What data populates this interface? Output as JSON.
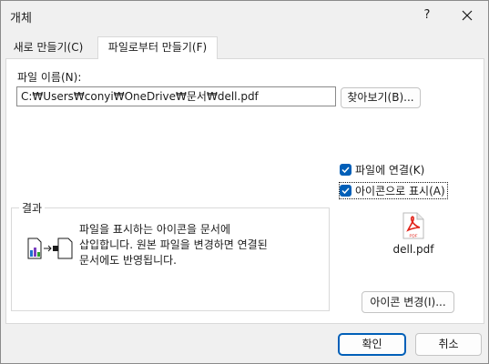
{
  "window": {
    "title": "개체",
    "help_label": "?"
  },
  "tabs": [
    {
      "label": "새로 만들기(C)",
      "active": false
    },
    {
      "label": "파일로부터 만들기(F)",
      "active": true
    }
  ],
  "file": {
    "label": "파일 이름(N):",
    "value": "C:₩Users₩conyi₩OneDrive₩문서₩dell.pdf",
    "browse_label": "찾아보기(B)..."
  },
  "options": {
    "link_label": "파일에 연결(K)",
    "link_checked": true,
    "icon_label": "아이콘으로 표시(A)",
    "icon_checked": true
  },
  "preview_icon": {
    "icon": "pdf-file-icon",
    "badge": "PDF",
    "filename": "dell.pdf",
    "color": "#e2231a"
  },
  "result": {
    "legend": "결과",
    "text": "파일을 표시하는 아이콘을 문서에\n삽입합니다. 원본 파일을 변경하면 연결된\n문서에도 반영됩니다."
  },
  "buttons": {
    "change_icon": "아이콘 변경(I)...",
    "ok": "확인",
    "cancel": "취소"
  },
  "colors": {
    "accent": "#005fb8",
    "dialog_bg": "#f0f0f0",
    "panel_bg": "#ffffff"
  }
}
